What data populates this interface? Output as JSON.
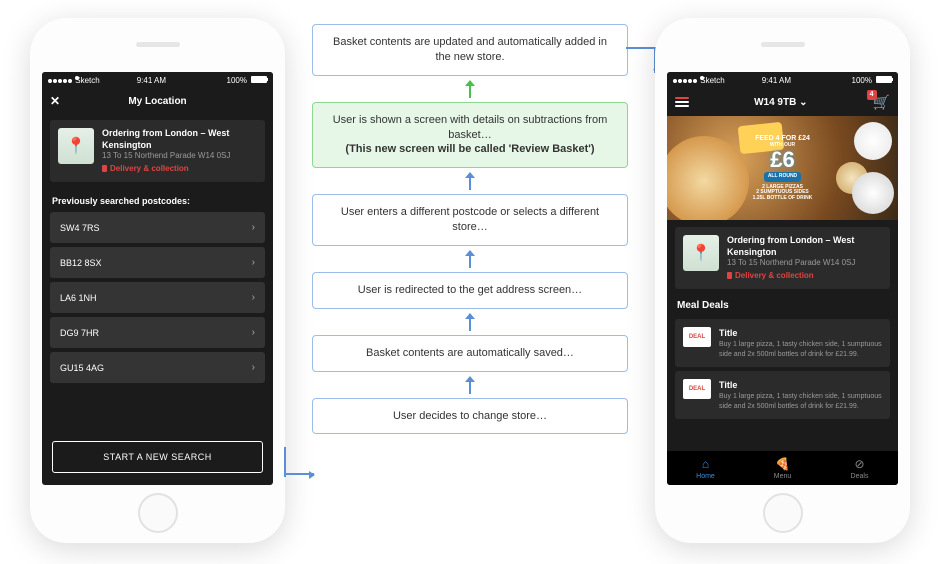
{
  "statusbar": {
    "carrier": "Sketch",
    "time": "9:41 AM",
    "battery": "100%"
  },
  "left_phone": {
    "title": "My Location",
    "store": {
      "name": "Ordering from London – West Kensington",
      "address": "13 To 15 Northend Parade W14 0SJ",
      "tag": "Delivery & collection"
    },
    "prev_label": "Previously searched postcodes:",
    "postcodes": [
      "SW4 7RS",
      "BB12 8SX",
      "LA6 1NH",
      "DG9 7HR",
      "GU15 4AG"
    ],
    "cta": "START A NEW SEARCH"
  },
  "right_phone": {
    "header_title": "W14 9TB",
    "cart_count": "4",
    "banner": {
      "top": "FEED 4 FOR £24",
      "with": "WITH OUR",
      "price": "£6",
      "sub": "ALL ROUND",
      "lines": "2 LARGE PIZZAS\n2 SUMPTUOUS SIDES\n1.25L BOTTLE OF DRINK"
    },
    "store": {
      "name": "Ordering from London – West Kensington",
      "address": "13 To 15 Northend Parade W14 0SJ",
      "tag": "Delivery & collection"
    },
    "section": "Meal Deals",
    "deals": [
      {
        "badge": "DEAL",
        "title": "Title",
        "desc": "Buy 1 large pizza, 1 tasty chicken side, 1 sumptuous side and 2x 500ml bottles of drink for £21.99."
      },
      {
        "badge": "DEAL",
        "title": "Title",
        "desc": "Buy 1 large pizza, 1 tasty chicken side, 1 sumptuous side and 2x 500ml bottles of drink for £21.99."
      }
    ],
    "tabs": [
      "Home",
      "Menu",
      "Deals"
    ]
  },
  "flow": {
    "s0": "Basket contents are updated and automatically added in the new store.",
    "s1a": "User is shown a screen with details on subtractions from basket…",
    "s1b": "(This new screen will be called 'Review Basket')",
    "s2": "User enters a different postcode or selects a different store…",
    "s3": "User is redirected to the get address screen…",
    "s4": "Basket contents are automatically saved…",
    "s5": "User decides to change store…"
  }
}
